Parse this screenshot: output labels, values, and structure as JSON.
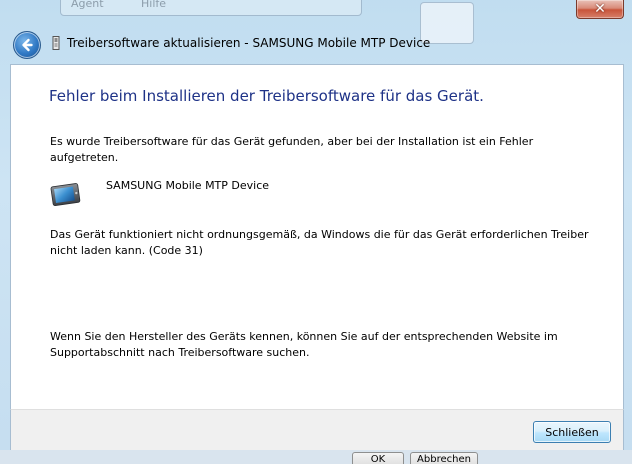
{
  "window": {
    "title": "Treibersoftware aktualisieren - SAMSUNG Mobile MTP Device"
  },
  "background": {
    "tab_1": "Agent",
    "tab_2": "Hilfe"
  },
  "content": {
    "heading": "Fehler beim Installieren der Treibersoftware für das Gerät.",
    "found_message": "Es wurde Treibersoftware für das Gerät gefunden, aber bei der Installation ist ein Fehler aufgetreten.",
    "device_name": "SAMSUNG Mobile MTP Device",
    "error_message": "Das Gerät funktioniert nicht ordnungsgemäß, da Windows die für das Gerät erforderlichen Treiber nicht laden kann. (Code 31)",
    "hint_message": "Wenn Sie den Hersteller des Geräts kennen, können Sie auf der entsprechenden Website im Supportabschnitt nach Treibersoftware suchen."
  },
  "footer": {
    "close_label": "Schließen"
  },
  "background_buttons": {
    "ok_label": "OK",
    "abort_label": "Abbrechen"
  },
  "icons": {
    "back": "back-arrow-icon",
    "title": "driver-icon",
    "device": "mobile-device-icon",
    "close": "close-icon"
  },
  "colors": {
    "heading": "#1e3287",
    "accent": "#3c7fb1",
    "close_red": "#c8543a"
  }
}
